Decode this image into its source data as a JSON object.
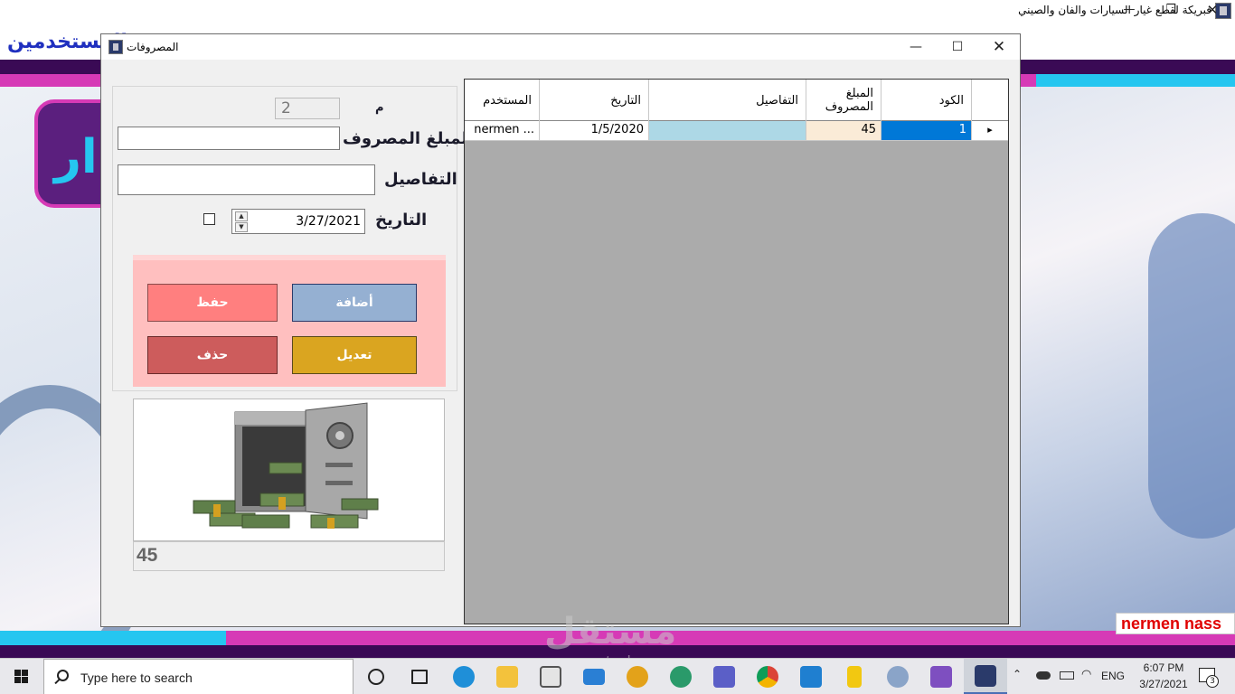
{
  "main_window": {
    "title": "فبريكة لقطع غيار السيارات والفان والصيني",
    "menu_text": "المستخدمين",
    "user_label": "nermen nass",
    "controls": {
      "minimize": "—",
      "maximize": "❐",
      "close": "✕"
    },
    "colors": {
      "menu_text": "#1f2fbf",
      "accent_pink": "#d63ab6",
      "accent_cyan": "#25c6f0",
      "accent_dark": "#3a0a55"
    }
  },
  "expenses_window": {
    "title": "المصروفات",
    "controls": {
      "minimize": "—",
      "maximize": "☐",
      "close": "✕"
    },
    "form": {
      "id_label": "م",
      "id_value": "2",
      "amount_label": "المبلغ المصروف",
      "amount_value": "",
      "details_label": "التفاصيل",
      "details_value": "",
      "date_label": "التاريخ",
      "date_value": "3/27/2021",
      "date_checked": false
    },
    "buttons": {
      "add": "أضافة",
      "save": "حفظ",
      "edit": "تعديل",
      "delete": "حذف"
    },
    "total_value": "45",
    "grid": {
      "headers": {
        "code": "الكود",
        "amount": "المبلغ المصروف",
        "details": "التفاصيل",
        "date": "التاريخ",
        "user": "المستخدم"
      },
      "rows": [
        {
          "code": "1",
          "amount": "45",
          "details": "",
          "date": "1/5/2020",
          "user": "nermen ..."
        }
      ],
      "row_indicator": "▸"
    }
  },
  "taskbar": {
    "search_placeholder": "Type here to search",
    "language": "ENG",
    "time": "6:07 PM",
    "date": "3/27/2021",
    "notifications": "3",
    "apps": [
      "task-view-icon",
      "edge-icon",
      "file-explorer-icon",
      "store-icon",
      "mail-icon",
      "chrome-alt-icon",
      "edge-dev-icon",
      "teams-icon",
      "chrome-icon",
      "vscode-icon",
      "powerbi-icon",
      "paint-icon",
      "visual-studio-icon",
      "running-app-icon"
    ]
  },
  "watermark": {
    "arabic": "مستقل",
    "latin": "mostaql.com"
  }
}
